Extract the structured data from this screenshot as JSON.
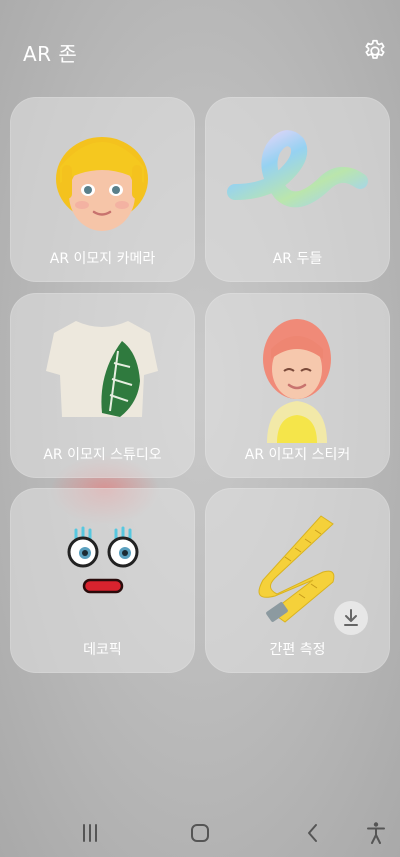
{
  "header": {
    "title": "AR 존",
    "settings_icon": "gear-icon"
  },
  "cards": [
    {
      "label": "AR 이모지 카메라",
      "icon": "emoji-avatar-blonde-girl"
    },
    {
      "label": "AR 두들",
      "icon": "doodle-ribbon"
    },
    {
      "label": "AR 이모지 스튜디오",
      "icon": "tshirt-leaf-print"
    },
    {
      "label": "AR 이모지 스티커",
      "icon": "emoji-avatar-pink-hair"
    },
    {
      "label": "데코픽",
      "icon": "cartoon-eyes-lips"
    },
    {
      "label": "간편 측정",
      "icon": "measuring-tape",
      "download_icon": "download-icon"
    }
  ],
  "navbar": {
    "recents_icon": "recents-icon",
    "home_icon": "home-icon",
    "back_icon": "back-icon",
    "accessibility_icon": "accessibility-icon"
  },
  "colors": {
    "background": "#bdbdbd",
    "card": "#d9d9d9",
    "text": "#ffffff"
  }
}
